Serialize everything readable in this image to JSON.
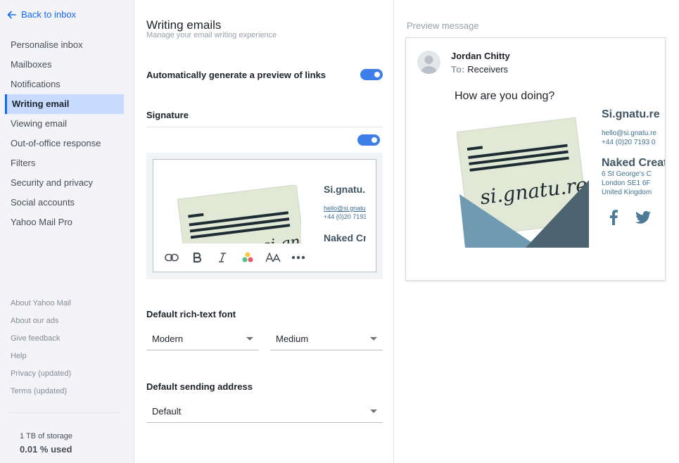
{
  "sidebar": {
    "back_label": "Back to inbox",
    "items": [
      {
        "label": "Personalise inbox"
      },
      {
        "label": "Mailboxes"
      },
      {
        "label": "Notifications"
      },
      {
        "label": "Writing email",
        "active": true
      },
      {
        "label": "Viewing email"
      },
      {
        "label": "Out-of-office response"
      },
      {
        "label": "Filters"
      },
      {
        "label": "Security and privacy"
      },
      {
        "label": "Social accounts"
      },
      {
        "label": "Yahoo Mail Pro"
      }
    ],
    "footer": [
      {
        "label": "About Yahoo Mail"
      },
      {
        "label": "About our ads"
      },
      {
        "label": "Give feedback"
      },
      {
        "label": "Help"
      },
      {
        "label": "Privacy (updated)"
      },
      {
        "label": "Terms (updated)"
      }
    ],
    "storage_total": "1 TB of storage",
    "storage_used": "0.01 % used"
  },
  "settings": {
    "title": "Writing emails",
    "subtitle": "Manage your email writing experience",
    "link_preview_label": "Automatically generate a preview of links",
    "link_preview_on": true,
    "signature_label": "Signature",
    "signature_on": true,
    "font_label": "Default rich-text font",
    "font_family_value": "Modern",
    "font_size_value": "Medium",
    "sending_label": "Default sending address",
    "sending_value": "Default"
  },
  "signature": {
    "name": "Si.gnatu.re",
    "email": "hello@si.gnatu.re",
    "phone": "+44 (0)20 7193 0",
    "company": "Naked Creativ",
    "address": [
      "6 St George's C",
      "London SE1 6F",
      "United Kingdom"
    ],
    "logo_text": "si.gnatu.re"
  },
  "preview": {
    "label": "Preview message",
    "sender": "Jordan Chitty",
    "to_label": "To:",
    "to_value": "Receivers",
    "greeting": "How are you doing?"
  },
  "colors": {
    "accent": "#0f69ff",
    "toggle": "#3d7eea",
    "active_bg": "#c7dcff",
    "signature_dark": "#3f5563",
    "signature_link": "#3f6f8f"
  }
}
